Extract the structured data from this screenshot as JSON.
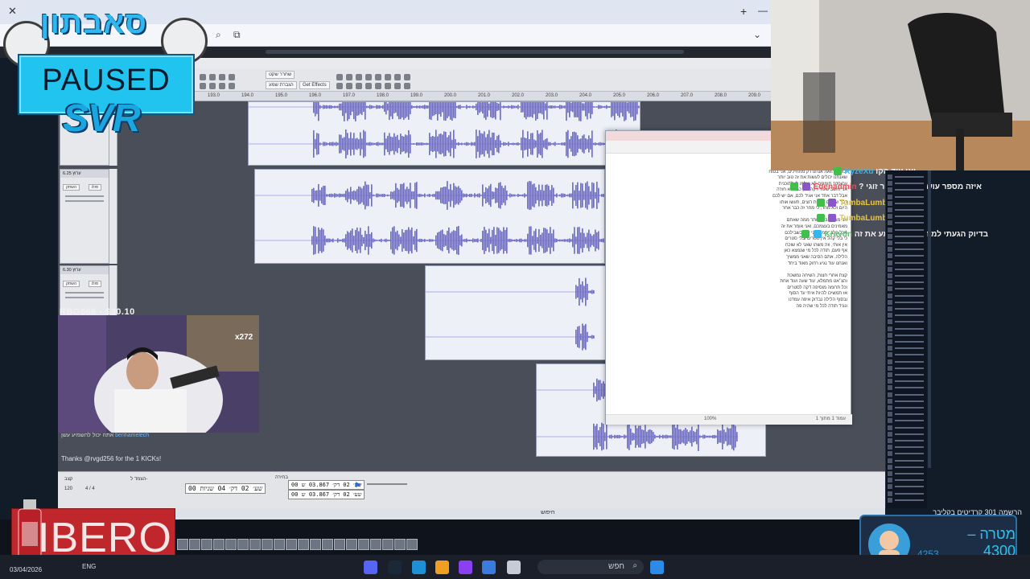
{
  "overlay": {
    "logo_text": "סאבתון",
    "paused_label": "PAUSED",
    "svr_label": "SVR",
    "sponsor_label": "IBERO"
  },
  "browser": {
    "close_glyph": "✕",
    "new_tab_glyph": "+",
    "minimize_glyph": "—"
  },
  "editor": {
    "ruler_ticks": [
      "193.0",
      "194.0",
      "195.0",
      "196.0",
      "197.0",
      "198.0",
      "199.0",
      "200.0",
      "201.0",
      "202.0",
      "203.0",
      "204.0",
      "205.0",
      "206.0",
      "207.0",
      "208.0",
      "209.0",
      "210.0",
      "211.0"
    ],
    "tracks": [
      {
        "name": "6.25 ערוץ",
        "mute": "השתק",
        "solo": "סולו"
      },
      {
        "name": "6.30 ערוץ",
        "mute": "השתק",
        "solo": "סולו"
      }
    ],
    "toolbar_buttons": [
      "שחרר שקט",
      "הגברת שמע",
      "Get Effects"
    ],
    "tempo_label": "קצב",
    "tempo_value": "120",
    "time_sig": "4 / 4",
    "snap_label": "הצמד ל-",
    "time_display": "00 שע׳ 02 דק׳ 04 שניות",
    "selection_start": "00 שע׳ 02 דק׳ 03.867 ש",
    "selection_end": "00 שע׳ 02 דק׳ 03.867 ש",
    "selection_label": "בחירה"
  },
  "doc": {
    "status_left": "עמוד 1 מתוך 1",
    "status_right": "100%",
    "lines": [
      "פאקינג תחשבו שוב, סתם מבנה עוד אחד",
      "ובשנה הזאת אנחנו רק מתחילים, אני בטוח",
      "שאנחנו יכולים לעשות את זה טוב יותר",
      "עם 100 תומכים לא יעלמו לי לתוכנית",
      "אני חושב שעוד דקה, רק כבר לא חזרה",
      "אבל דבר אחד אני אגיד לכם, אם יש לכם",
      "דבר שאתם באמת רוצים, תעשו אותו",
      "היום ולא מחר, כי מחר זה כבר אחר",
      "",
      "אני מאמין בכם יותר ממה שאתם",
      "מאמינים בעצמכם, ואני אומר את זה",
      "מכל הלב, תמיד אני כאן בשבילכם",
      "כי בלי קהל אין סטרים ובלי סטרים",
      "אין אותי, וזה משהו שאני לא שוכח",
      "אף פעם, תודה לכל מי שנמצא כאן",
      "הלילה, אתם הסיבה שאני ממשיך",
      "ואנחנו עוד נגיע רחוק מאוד ביחד",
      "",
      "קצת אחרי חצות, השיחה נמשכת",
      "והצ׳אט מתמלא, עוד שעה ועוד אחת",
      "וכל תרומה מוסיפה דקה לסטרים",
      "אז תמשיכו להיות איתי עד הסוף",
      "ובסוף הלילה נבדוק איפה עמדנו",
      "ונגיד תודה לכל מי שהיה פה"
    ]
  },
  "chat": {
    "messages": [
      {
        "user": "RyzeXu",
        "text": "יאו עוד הקו"
      },
      {
        "user": "Edenadmin",
        "text": "איזה מספר עושה את הגניפר זוגי ?"
      },
      {
        "user": "TumbaLumba",
        "text": ""
      },
      {
        "user": "TumbaLumba",
        "text": ""
      },
      {
        "user": "Kravdn",
        "text": "בדיוק הגעתי למחשב אני שומע את זה"
      }
    ],
    "kick_notice": "Thanks @rvgd256 for the 1 KICKs!",
    "mini_msg": "אתה יכול להשמיע עשן",
    "mini_user": "benhamelech"
  },
  "facecam": {
    "donor_line": "RBG666 - $30.10",
    "sub_count": "x272"
  },
  "donation": {
    "top_text": "הרשמה 301 קרדיטים בקליבר",
    "goal_label": "מטרה",
    "goal_value": "4300",
    "current_value": "4253",
    "dash": "–"
  },
  "taskbar": {
    "search_placeholder": "חפש",
    "date": "03/04/2026",
    "lang": "ENG",
    "inner_search": "חיפוש"
  },
  "colors": {
    "wave": "#6b66d6",
    "accent": "#21c4ef",
    "sponsor": "#c0272d"
  }
}
